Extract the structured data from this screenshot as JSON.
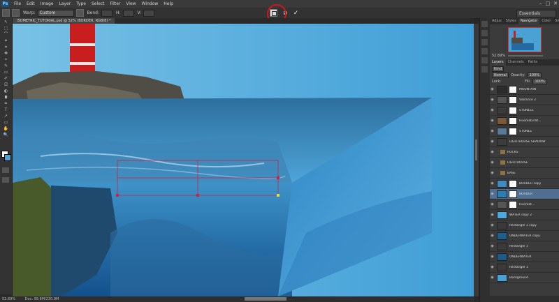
{
  "app": {
    "logo": "Ps"
  },
  "menu": [
    "File",
    "Edit",
    "Image",
    "Layer",
    "Type",
    "Select",
    "Filter",
    "View",
    "Window",
    "Help"
  ],
  "window_controls": [
    "–",
    "□",
    "✕"
  ],
  "options_bar": {
    "warp_label": "Warp:",
    "warp_value": "Custom",
    "bend_label": "Bend:",
    "bend_value": "",
    "h_label": "H:",
    "h_value": "",
    "v_label": "V:",
    "v_value": "",
    "cancel_glyph": "⊘",
    "commit_glyph": "✓",
    "workspace": "Essentials"
  },
  "document": {
    "tab_label": "ISOMETRIC_TUTORIAL.psd @ 52% (BORDER, RGB/8) *"
  },
  "status": {
    "zoom": "52.69%",
    "doc": "Doc: 99.8M/230.9M"
  },
  "tools": [
    "↖",
    "⬚",
    "⌒",
    "✦",
    "⌗",
    "✚",
    "⌖",
    "✎",
    "▭",
    "✐",
    "⎚",
    "◐",
    "⬮",
    "✒",
    "T",
    "↗",
    "▭",
    "✋",
    "🔍"
  ],
  "panels": {
    "top_tabs": [
      "Adjus",
      "Styles",
      "Navigator",
      "Color",
      "Swatch"
    ],
    "navigator_zoom": "52.69%",
    "layers_tabs": [
      "Layers",
      "Channels",
      "Paths"
    ],
    "kind_label": "Kind",
    "blend_mode": "Normal",
    "opacity_label": "Opacity:",
    "opacity_value": "100%",
    "lock_label": "Lock:",
    "fill_label": "Fill:",
    "fill_value": "100%",
    "layers": [
      {
        "name": "MOUNTAIN",
        "type": "mask",
        "color": "#2c2c2c"
      },
      {
        "name": "Vibrance 2",
        "type": "adjust",
        "color": "#555555"
      },
      {
        "name": "STONE11",
        "type": "mask",
        "color": "#3a3a3a"
      },
      {
        "name": "Hue/Saturat...",
        "type": "adjust",
        "color": "#7a5a3a"
      },
      {
        "name": "STONE1",
        "type": "mask",
        "color": "#5a7a9a"
      },
      {
        "name": "LIGHTHOUSE SHADOW",
        "type": "plain",
        "color": "#3c3c3c"
      },
      {
        "name": "ROCKS",
        "type": "group"
      },
      {
        "name": "LIGHTHOUSE",
        "type": "group"
      },
      {
        "name": "BASE",
        "type": "group"
      },
      {
        "name": "BORDER copy",
        "type": "mask",
        "color": "#3e8cc0"
      },
      {
        "name": "BORDER",
        "type": "mask",
        "color": "#2d7db5",
        "selected": true
      },
      {
        "name": "Hue/Sat...",
        "type": "adjust",
        "color": "#555555"
      },
      {
        "name": "WATER copy 2",
        "type": "plain",
        "color": "#4ea8da"
      },
      {
        "name": "Rectangle 1 copy",
        "type": "plain",
        "color": "#3a3a3a"
      },
      {
        "name": "UNDERWATER copy",
        "type": "plain",
        "color": "#1f5f8f"
      },
      {
        "name": "Rectangle 1",
        "type": "plain",
        "color": "#3a3a3a"
      },
      {
        "name": "UNDERWATER",
        "type": "plain",
        "color": "#1d5a88"
      },
      {
        "name": "Rectangle 1",
        "type": "plain",
        "color": "#3a3a3a"
      },
      {
        "name": "Background",
        "type": "plain",
        "color": "#4aa2d4"
      }
    ]
  }
}
